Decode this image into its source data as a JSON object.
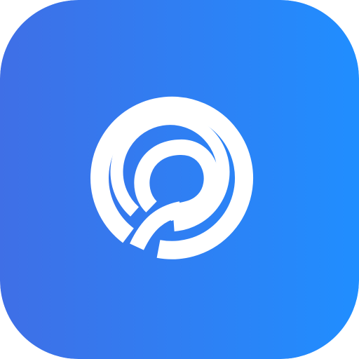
{
  "app_icon": {
    "icon": "circular-location-pin-logo-icon",
    "colors": {
      "gradient_start": "#3F6FE6",
      "gradient_end": "#208EFF",
      "glyph": "#FFFFFF"
    }
  }
}
